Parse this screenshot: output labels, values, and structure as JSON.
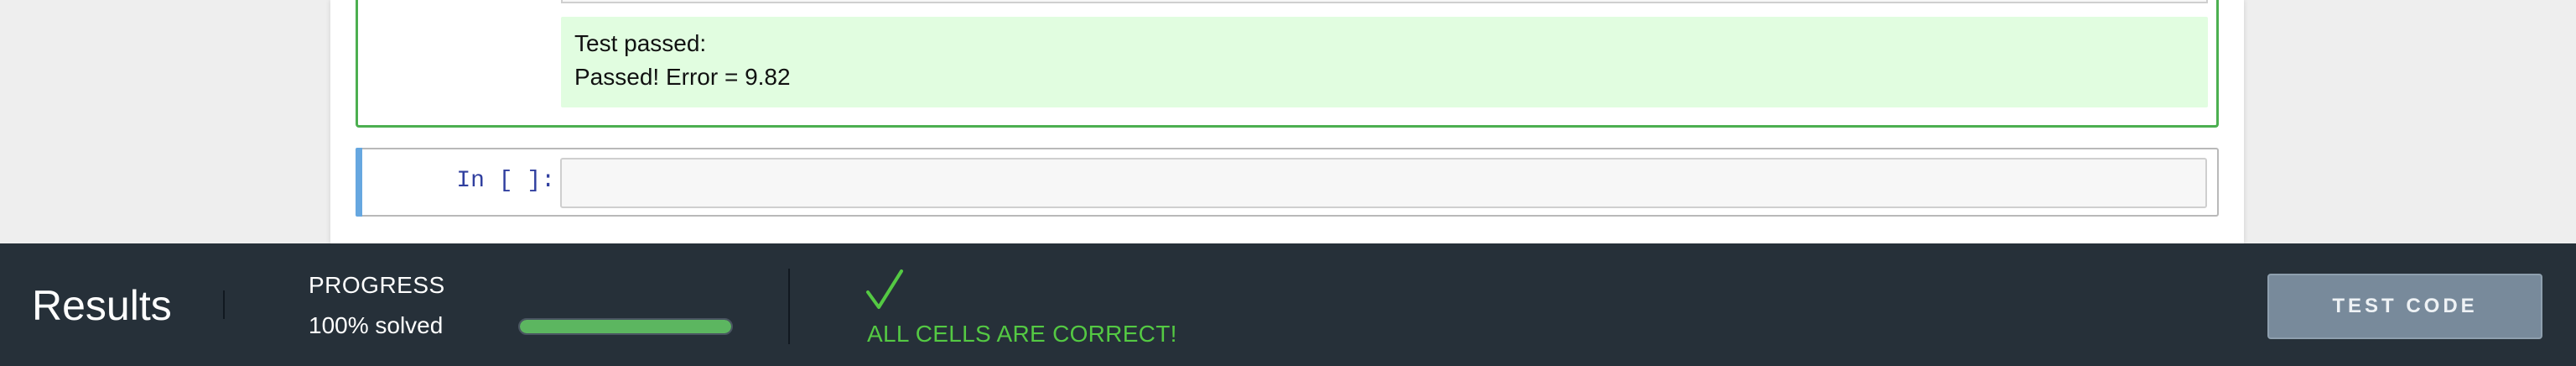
{
  "notebook": {
    "test_output_lines": [
      "Test passed:",
      "Passed! Error = 9.82"
    ],
    "empty_cell_prompt": "In [ ]:",
    "empty_cell_value": ""
  },
  "results_bar": {
    "title": "Results",
    "progress_label": "PROGRESS",
    "progress_text": "100% solved",
    "progress_fraction": 1.0,
    "status_text": "ALL CELLS ARE CORRECT!",
    "status_icon": "checkmark-icon",
    "test_button_label": "TEST CODE"
  },
  "colors": {
    "bar_background": "#263039",
    "success_green": "#54c943",
    "progress_fill": "#5cb660",
    "pass_background": "#e1fde0",
    "cell_done_border": "#4caf50",
    "selected_cell_bar": "#66a7e0",
    "button_background": "#788a9b"
  }
}
